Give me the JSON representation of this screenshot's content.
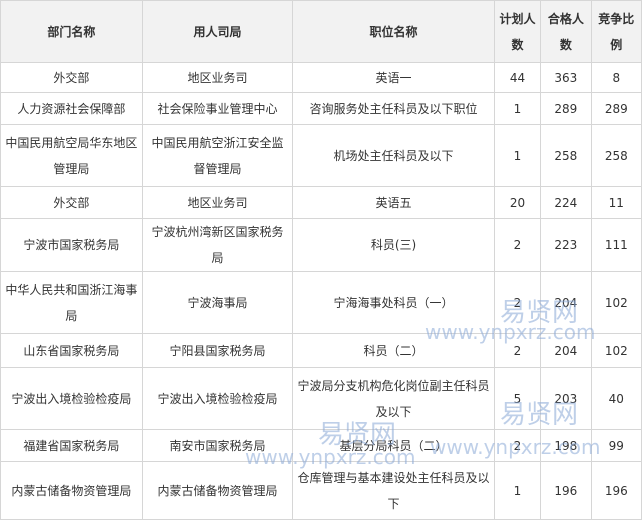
{
  "table": {
    "headers": {
      "department": "部门名称",
      "bureau": "用人司局",
      "position": "职位名称",
      "planned": "计划人数",
      "qualified": "合格人数",
      "ratio": "竞争比例"
    },
    "rows": [
      {
        "department": "外交部",
        "bureau": "地区业务司",
        "position": "英语一",
        "planned": "44",
        "qualified": "363",
        "ratio": "8"
      },
      {
        "department": "人力资源社会保障部",
        "bureau": "社会保险事业管理中心",
        "position": "咨询服务处主任科员及以下职位",
        "planned": "1",
        "qualified": "289",
        "ratio": "289"
      },
      {
        "department": "中国民用航空局华东地区管理局",
        "bureau": "中国民用航空浙江安全监督管理局",
        "position": "机场处主任科员及以下",
        "planned": "1",
        "qualified": "258",
        "ratio": "258"
      },
      {
        "department": "外交部",
        "bureau": "地区业务司",
        "position": "英语五",
        "planned": "20",
        "qualified": "224",
        "ratio": "11"
      },
      {
        "department": "宁波市国家税务局",
        "bureau": "宁波杭州湾新区国家税务局",
        "position": "科员(三)",
        "planned": "2",
        "qualified": "223",
        "ratio": "111"
      },
      {
        "department": "中华人民共和国浙江海事局",
        "bureau": "宁波海事局",
        "position": "宁海海事处科员（一）",
        "planned": "2",
        "qualified": "204",
        "ratio": "102"
      },
      {
        "department": "山东省国家税务局",
        "bureau": "宁阳县国家税务局",
        "position": "科员（二）",
        "planned": "2",
        "qualified": "204",
        "ratio": "102"
      },
      {
        "department": "宁波出入境检验检疫局",
        "bureau": "宁波出入境检验检疫局",
        "position": "宁波局分支机构危化岗位副主任科员及以下",
        "planned": "5",
        "qualified": "203",
        "ratio": "40"
      },
      {
        "department": "福建省国家税务局",
        "bureau": "南安市国家税务局",
        "position": "基层分局科员（二）",
        "planned": "2",
        "qualified": "198",
        "ratio": "99"
      },
      {
        "department": "内蒙古储备物资管理局",
        "bureau": "内蒙古储备物资管理局",
        "position": "仓库管理与基本建设处主任科员及以下",
        "planned": "1",
        "qualified": "196",
        "ratio": "196"
      }
    ]
  },
  "watermark": {
    "cn": "易贤网",
    "en": "www.ynpxrz.com"
  }
}
